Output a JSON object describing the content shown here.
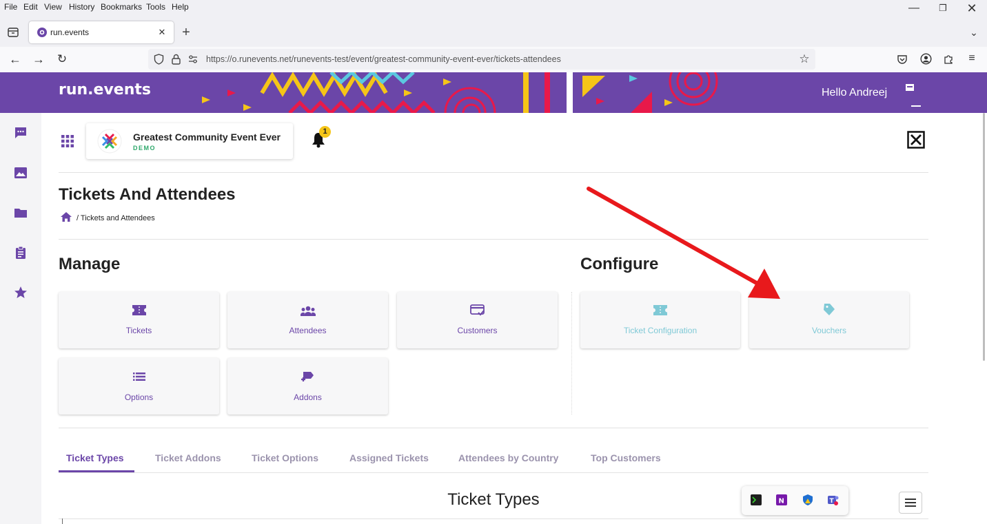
{
  "browser": {
    "menu": [
      "File",
      "Edit",
      "View",
      "History",
      "Bookmarks",
      "Tools",
      "Help"
    ],
    "tab_title": "run.events",
    "url": "https://o.runevents.net/runevents-test/event/greatest-community-event-ever/tickets-attendees"
  },
  "header": {
    "logo": "run.events",
    "greeting": "Hello Andreej"
  },
  "event": {
    "name": "Greatest Community Event Ever",
    "badge": "DEMO",
    "notification_count": "1"
  },
  "page": {
    "title": "Tickets And Attendees",
    "breadcrumb": "/ Tickets and Attendees"
  },
  "manage": {
    "heading": "Manage",
    "cards": [
      "Tickets",
      "Attendees",
      "Customers",
      "Options",
      "Addons"
    ]
  },
  "configure": {
    "heading": "Configure",
    "cards": [
      "Ticket Configuration",
      "Vouchers"
    ]
  },
  "tabs": [
    "Ticket Types",
    "Ticket Addons",
    "Ticket Options",
    "Assigned Tickets",
    "Attendees by Country",
    "Top Customers"
  ],
  "section": {
    "title": "Ticket Types"
  },
  "colors": {
    "brand": "#6b46a8",
    "configure_text": "#7fc9d6",
    "annotation_arrow": "#e8191c"
  }
}
